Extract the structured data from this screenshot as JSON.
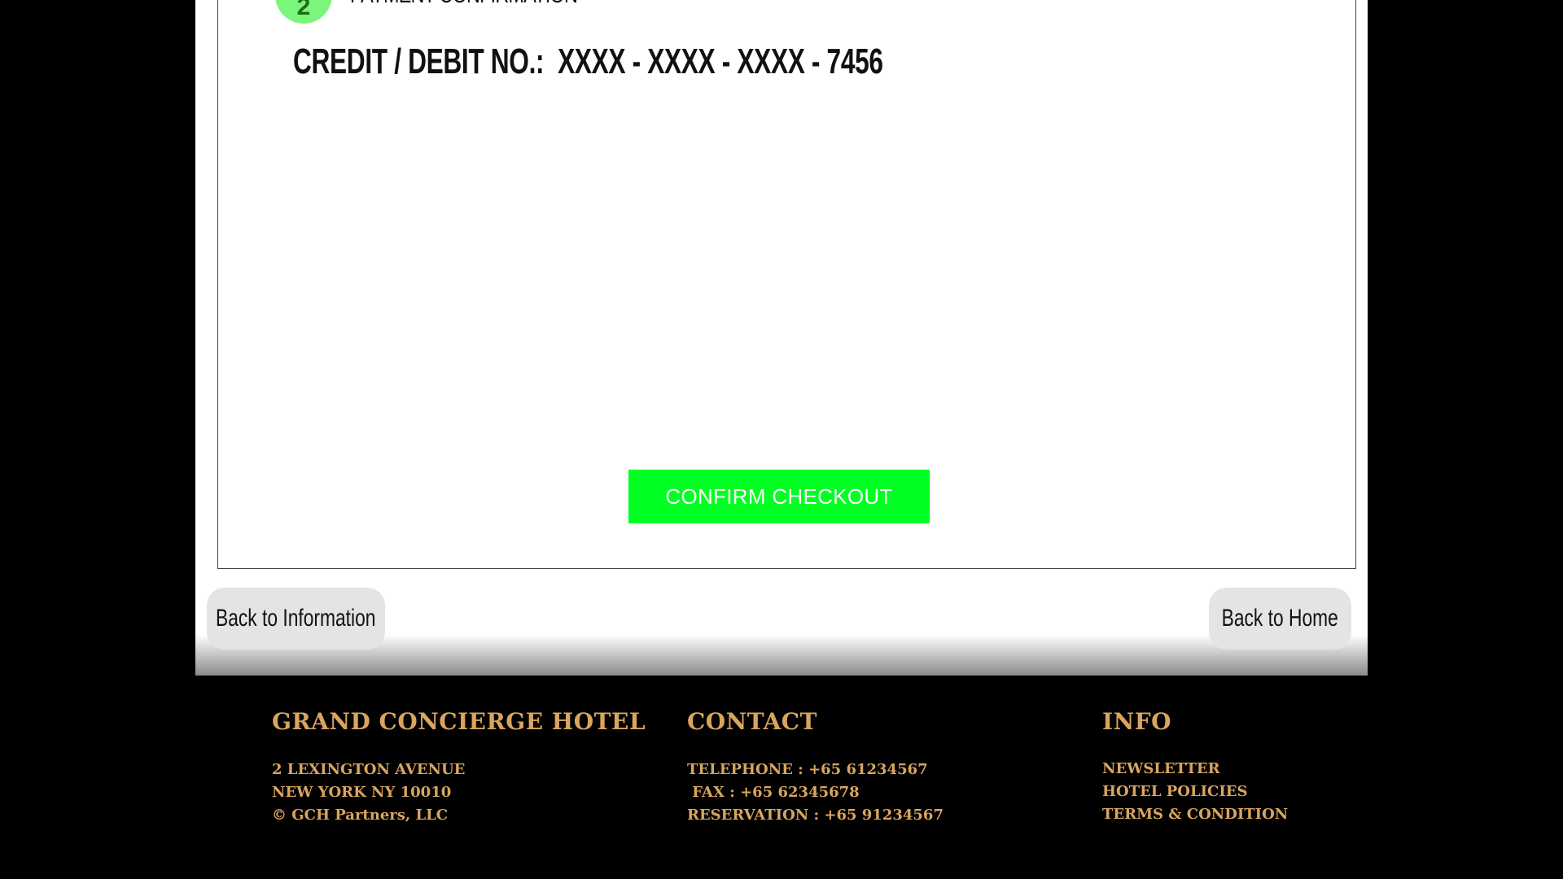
{
  "step": {
    "number": "2",
    "title": "PAYMENT CONFIRMATION"
  },
  "payment": {
    "card_label": "CREDIT / DEBIT NO.:",
    "card_number": "XXXX - XXXX - XXXX - 7456"
  },
  "actions": {
    "confirm_label": "CONFIRM CHECKOUT",
    "back_info_label": "Back to Information",
    "back_home_label": "Back to Home"
  },
  "footer": {
    "hotel": {
      "heading": "GRAND CONCIERGE HOTEL",
      "lines": [
        "2 LEXINGTON AVENUE",
        "NEW YORK NY 10010",
        "© GCH Partners, LLC"
      ]
    },
    "contact": {
      "heading": "CONTACT",
      "lines": [
        "TELEPHONE : +65 61234567",
        " FAX : +65 62345678",
        "RESERVATION : +65 91234567"
      ]
    },
    "info": {
      "heading": "INFO",
      "links": [
        "NEWSLETTER",
        "HOTEL POLICIES",
        "TERMS & CONDITION"
      ]
    }
  },
  "colors": {
    "confirm_button": "#00ff22",
    "step_circle": "#7cf57c",
    "footer_text": "#d9a55e",
    "back_button": "#e4e4e4"
  }
}
